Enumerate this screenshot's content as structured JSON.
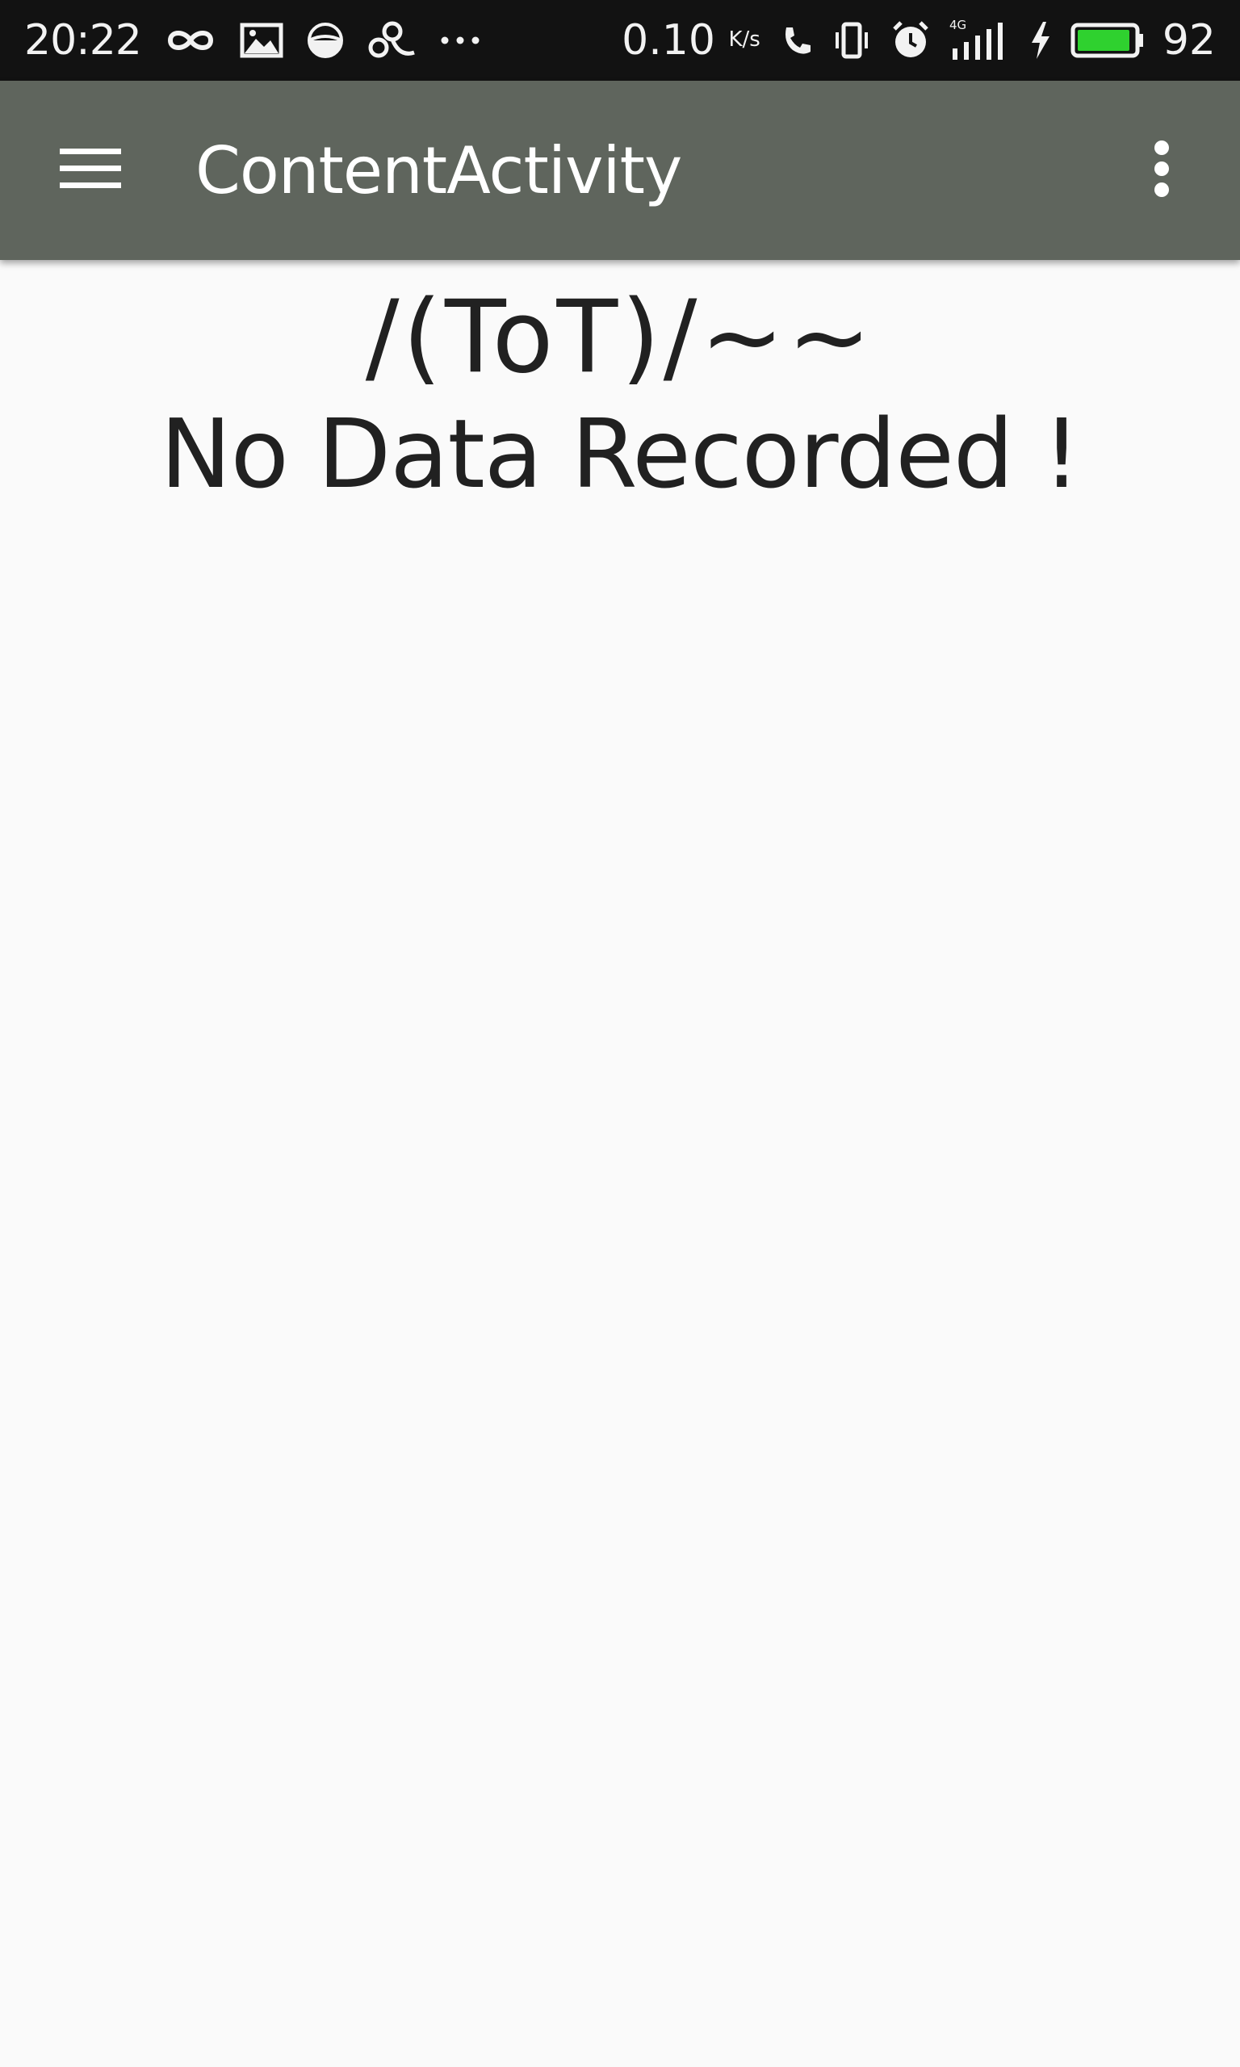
{
  "status_bar": {
    "time": "20:22",
    "net_speed": "0.10",
    "net_speed_unit": "K/s",
    "network_type": "4G",
    "battery_level": "92",
    "battery_color": "#2fd12f",
    "left_icons": [
      "infinity-icon",
      "image-icon",
      "half-circle-icon",
      "pinwheel-icon",
      "more-dots-icon"
    ],
    "right_icons": [
      "phone-call-icon",
      "vibrate-icon",
      "alarm-icon",
      "signal-icon",
      "charging-icon",
      "battery-icon"
    ]
  },
  "app_bar": {
    "title": "ContentActivity",
    "background": "#5f655d",
    "menu_icon": "hamburger-menu-icon",
    "overflow_icon": "overflow-menu-icon"
  },
  "empty_state": {
    "emoticon": "/(ToT)/~~",
    "message": "No Data Recorded !"
  }
}
